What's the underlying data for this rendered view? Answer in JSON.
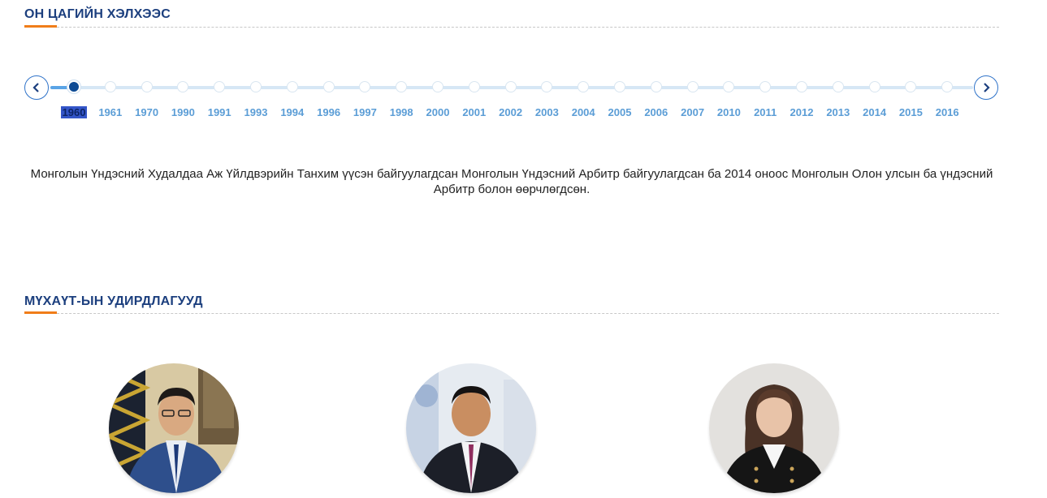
{
  "timeline_section": {
    "title": "ОН ЦАГИЙН ХЭЛХЭЭС",
    "years": [
      "1960",
      "1961",
      "1970",
      "1990",
      "1991",
      "1993",
      "1994",
      "1996",
      "1997",
      "1998",
      "2000",
      "2001",
      "2002",
      "2003",
      "2004",
      "2005",
      "2006",
      "2007",
      "2010",
      "2011",
      "2012",
      "2013",
      "2014",
      "2015",
      "2016"
    ],
    "selected_year": "1960",
    "description": "Монголын Үндэсний Худалдаа Аж Үйлдвэрийн Танхим үүсэн байгуулагдсан Монголын Үндэсний Арбитр байгуулагдсан ба 2014 оноос Монголын Олон улсын ба үндэсний Арбитр болон өөрчлөгдсөн.",
    "prev_icon": "chevron-left-icon",
    "next_icon": "chevron-right-icon"
  },
  "leaders_section": {
    "title": "МҮХАҮТ-ЫН УДИРДЛАГУУД",
    "leaders": [
      {
        "photo": "leader-photo-1"
      },
      {
        "photo": "leader-photo-2"
      },
      {
        "photo": "leader-photo-3"
      }
    ]
  },
  "colors": {
    "title": "#1c3f7e",
    "accent": "#f07d19",
    "year_link": "#5b9dd6",
    "active_dot": "#0d4a94"
  }
}
